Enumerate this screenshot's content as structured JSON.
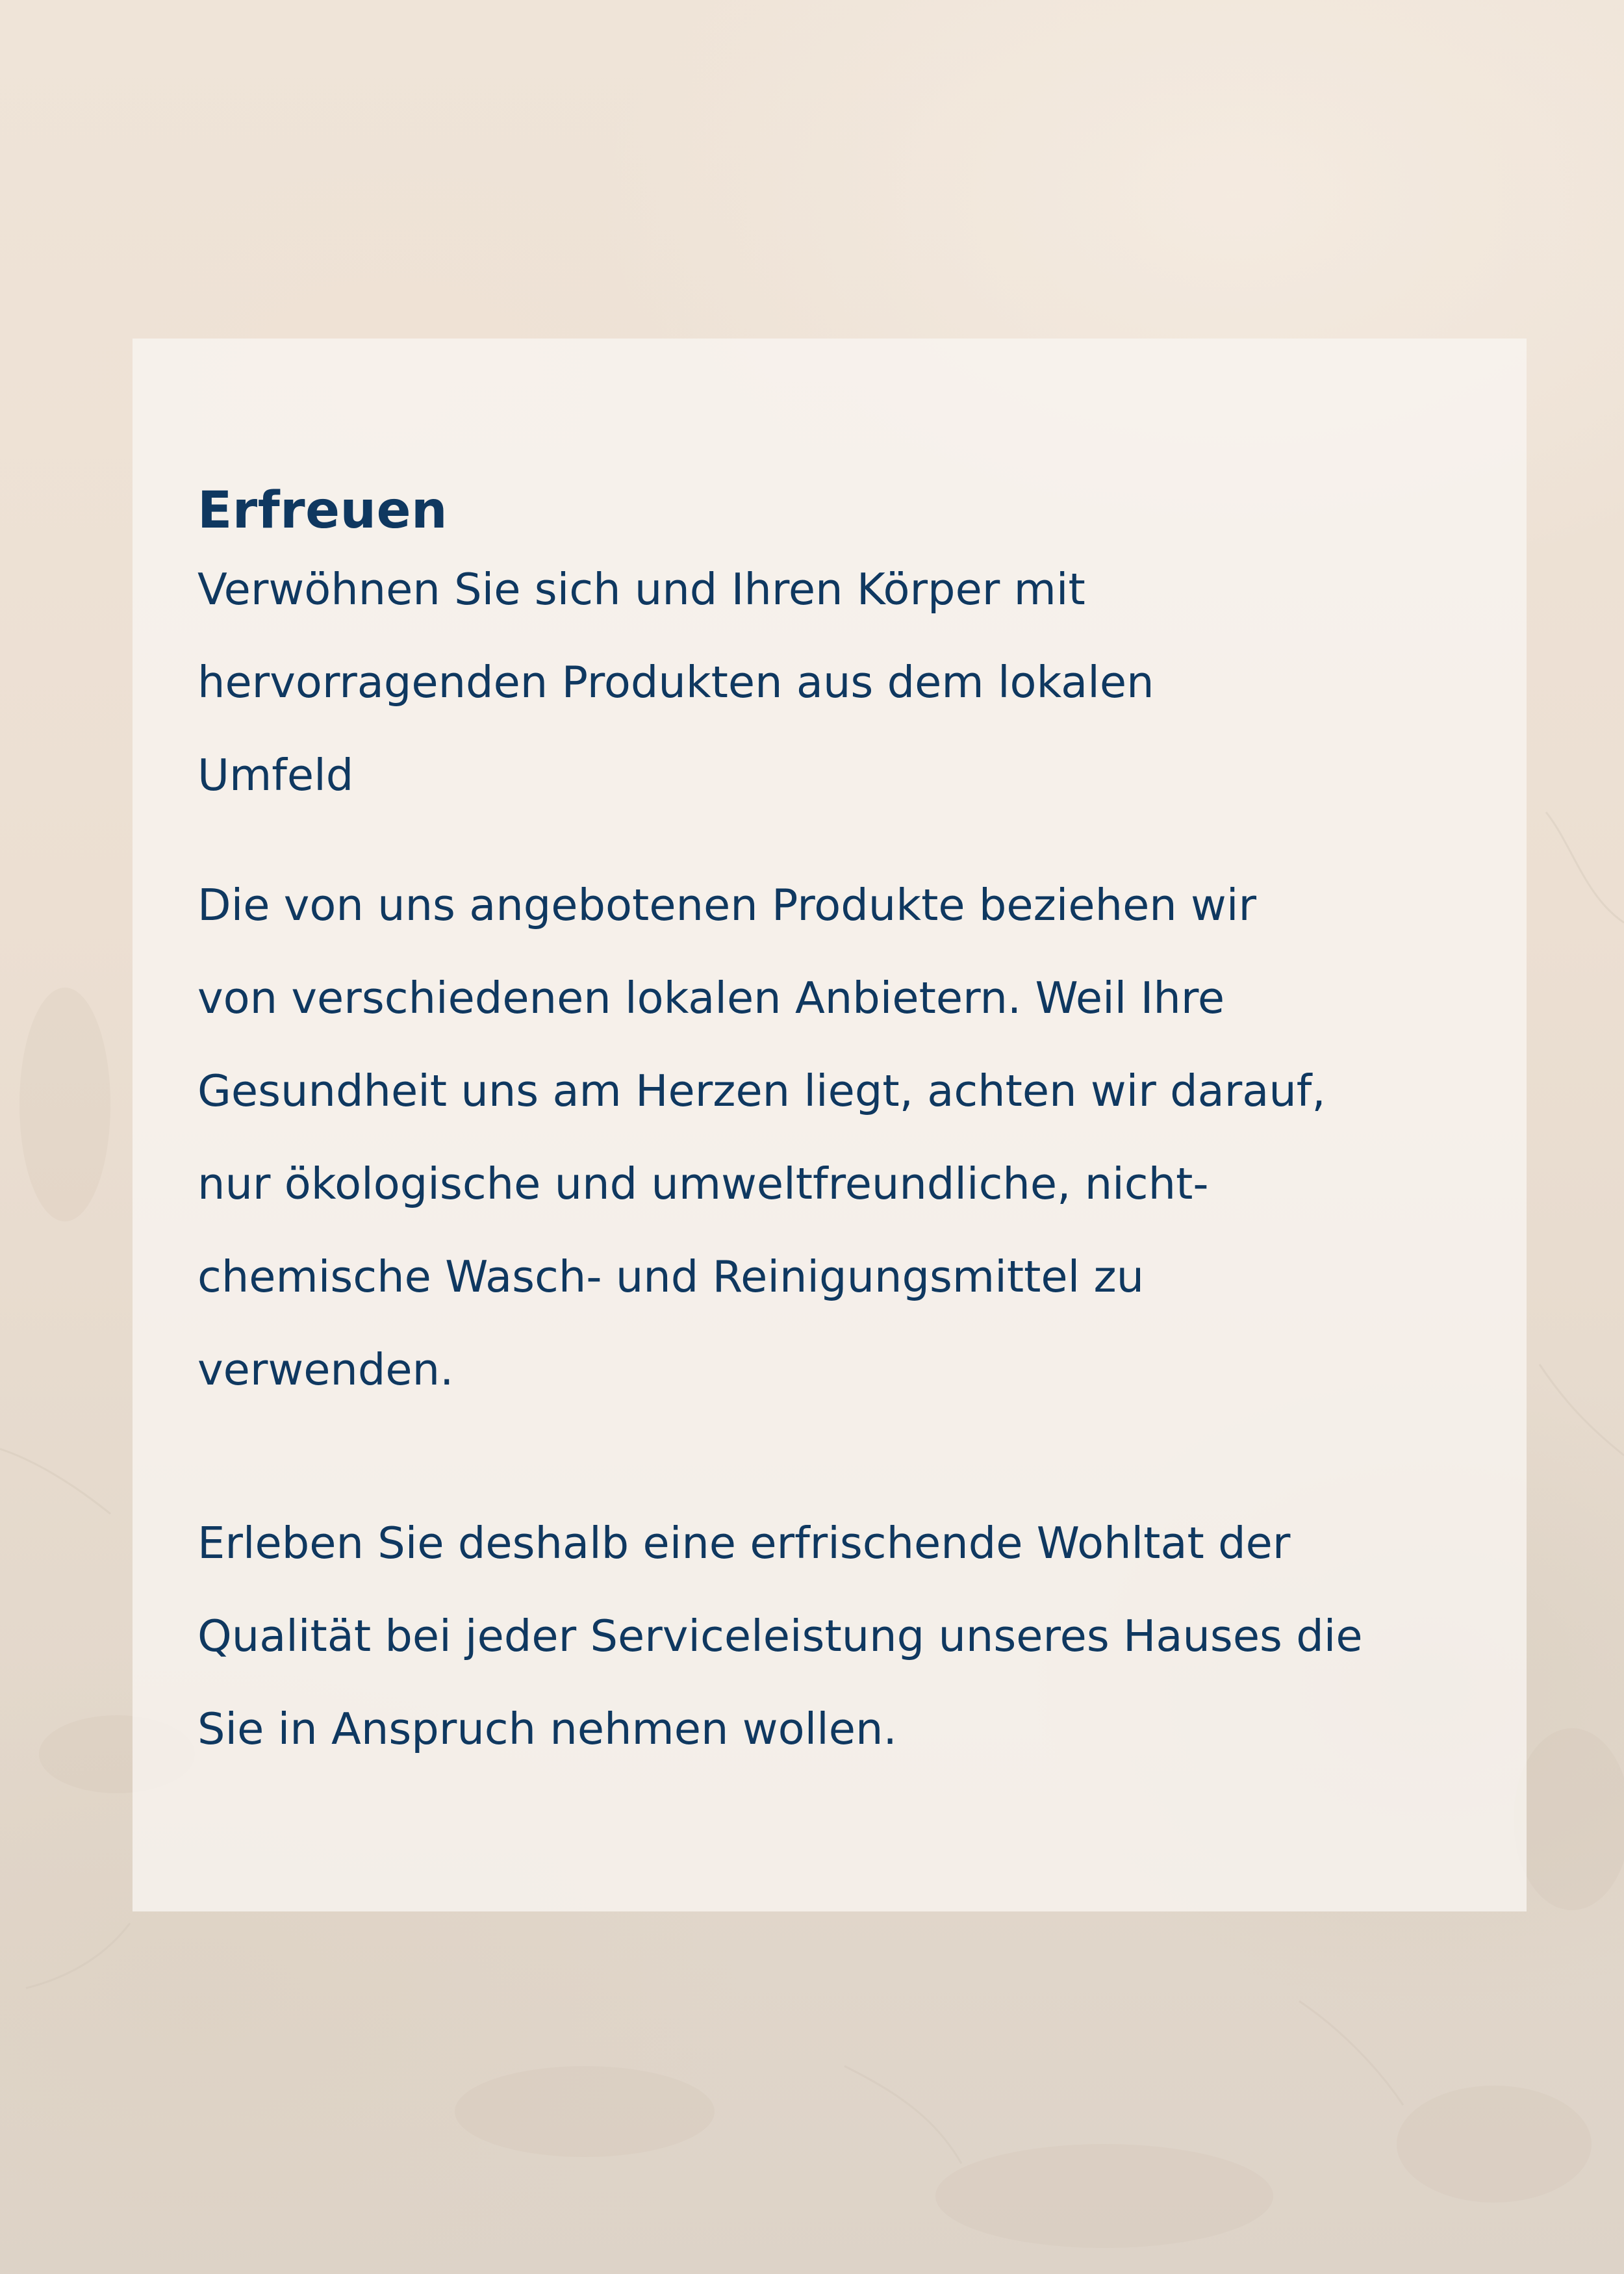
{
  "card": {
    "title": "Erfreuen",
    "subtitle": "Verwöhnen Sie sich und Ihren Körper mit\nhervorragenden Produkten aus dem lokalen\nUmfeld",
    "paragraph_1": "Die von uns angebotenen Produkte beziehen wir\nvon verschiedenen lokalen Anbietern. Weil Ihre\nGesundheit uns am Herzen liegt, achten wir darauf,\nnur ökologische und umweltfreundliche, nicht-\nchemische Wasch- und Reinigungsmittel zu\nverwenden.",
    "paragraph_2": "Erleben Sie deshalb eine erfrischende Wohltat der\nQualität bei jeder Serviceleistung unseres Hauses die\nSie in Anspruch nehmen wollen."
  },
  "colors": {
    "text": "#0f3860",
    "background": "#ecdfd2",
    "card": "#f9f5f1"
  }
}
